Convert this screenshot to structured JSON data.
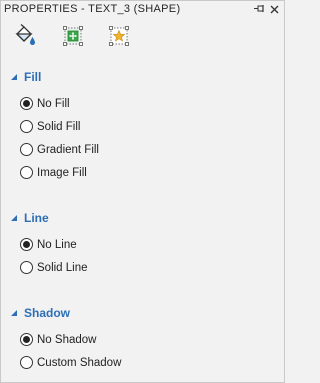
{
  "window": {
    "title": "PROPERTIES - TEXT_3 (SHAPE)"
  },
  "toolbar": {
    "buttons": [
      {
        "name": "fill-icon"
      },
      {
        "name": "size-position-icon"
      },
      {
        "name": "effects-icon"
      }
    ]
  },
  "sections": {
    "fill": {
      "title": "Fill",
      "options": [
        "No Fill",
        "Solid Fill",
        "Gradient Fill",
        "Image Fill"
      ],
      "selected": 0
    },
    "line": {
      "title": "Line",
      "options": [
        "No Line",
        "Solid Line"
      ],
      "selected": 0
    },
    "shadow": {
      "title": "Shadow",
      "options": [
        "No Shadow",
        "Custom Shadow"
      ],
      "selected": 0
    }
  },
  "colors": {
    "accent": "#2c6fb7",
    "background": "#f2f2f2",
    "icon_green": "#3aa64a",
    "icon_gold": "#f0b432"
  }
}
